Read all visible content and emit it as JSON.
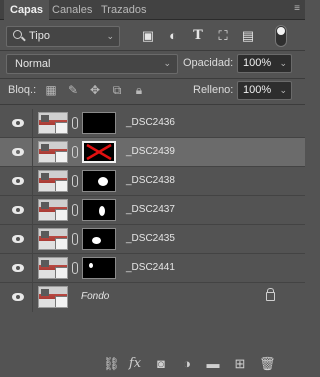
{
  "tabs": {
    "items": [
      "Capas",
      "Canales",
      "Trazados"
    ],
    "menu_icon": "panel-menu-icon"
  },
  "filter": {
    "kind_label": "Tipo",
    "icons": [
      "image-filter-icon",
      "adjustment-filter-icon",
      "type-filter-icon",
      "shape-filter-icon",
      "smart-object-filter-icon"
    ]
  },
  "blend": {
    "mode": "Normal",
    "opacity_label": "Opacidad:",
    "opacity_value": "100%"
  },
  "locks": {
    "label": "Bloq.:",
    "fill_label": "Relleno:",
    "fill_value": "100%",
    "icons": [
      "lock-transparent-icon",
      "lock-paint-icon",
      "lock-move-icon",
      "lock-artboard-icon",
      "lock-all-icon"
    ]
  },
  "layers": [
    {
      "name": "_DSC2436",
      "visible": true,
      "selected": false,
      "mask": "black"
    },
    {
      "name": "_DSC2439",
      "visible": true,
      "selected": true,
      "mask": "disabled"
    },
    {
      "name": "_DSC2438",
      "visible": true,
      "selected": false,
      "mask": "blob"
    },
    {
      "name": "_DSC2437",
      "visible": true,
      "selected": false,
      "mask": "blob"
    },
    {
      "name": "_DSC2435",
      "visible": true,
      "selected": false,
      "mask": "blob"
    },
    {
      "name": "_DSC2441",
      "visible": true,
      "selected": false,
      "mask": "blob"
    },
    {
      "name": "Fondo",
      "visible": true,
      "selected": false,
      "locked": true
    }
  ],
  "footer": {
    "icons": [
      "link-layers-icon",
      "fx-icon",
      "add-mask-icon",
      "adjustment-layer-icon",
      "new-group-icon",
      "new-layer-icon",
      "delete-layer-icon"
    ],
    "fx_label": "fx"
  },
  "colors": {
    "panel": "#535353",
    "selected_row": "#6b6b6b",
    "tab_bar": "#424242"
  }
}
